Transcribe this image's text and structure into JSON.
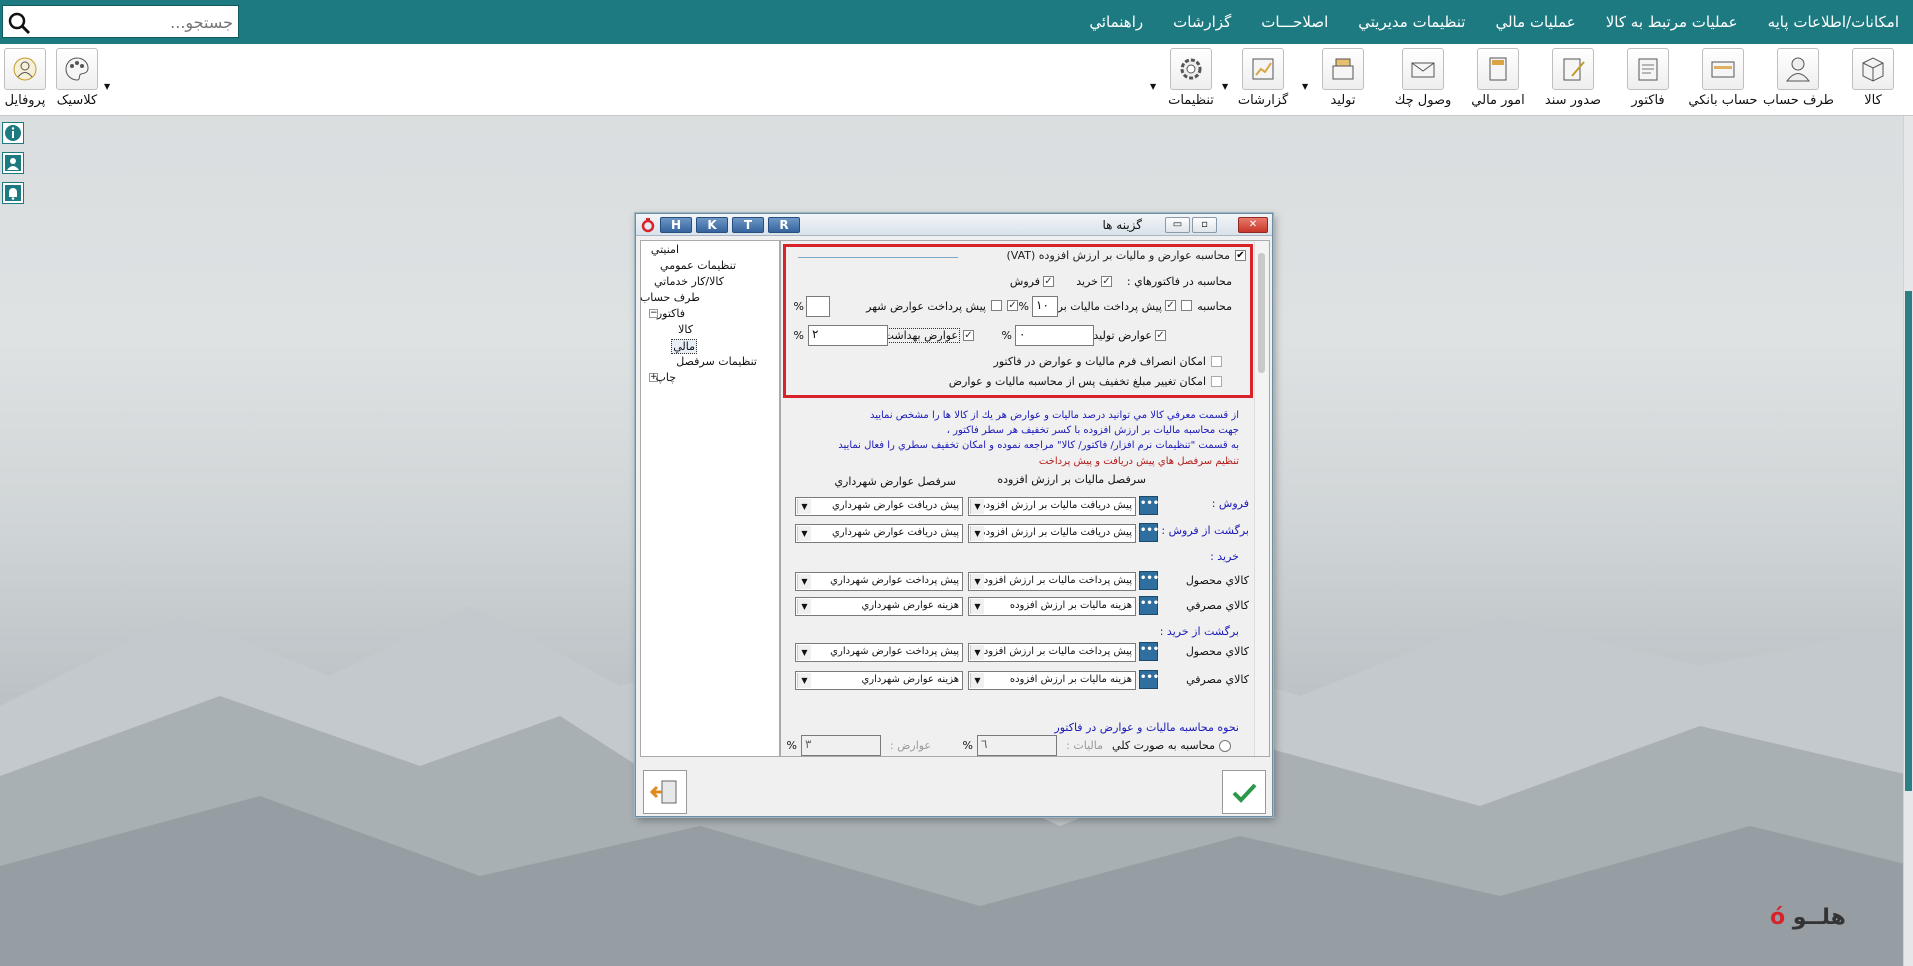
{
  "search": {
    "placeholder": "جستجو..."
  },
  "menu": [
    "امکانات/اطلاعات پايه",
    "عمليات مرتبط به کالا",
    "عمليات مالي",
    "تنظيمات مديريتي",
    "اصلاحـــات",
    "گزارشات",
    "راهنمائي"
  ],
  "toolbar": {
    "items": [
      "کالا",
      "طرف حساب",
      "حساب بانکي",
      "فاکتور",
      "صدور سند",
      "امور مالي",
      "وصول چك",
      "توليد",
      "گزارشات",
      "تنظيمات"
    ],
    "right_items": [
      "کلاسيک",
      "پروفايل"
    ]
  },
  "dialog": {
    "title": "گزينه ها",
    "hotkeys": [
      "H",
      "K",
      "T",
      "R"
    ],
    "tree": [
      "امنيتي",
      "تنظيمات عمومي",
      "کالا/کار خدماتي",
      "طرف حساب",
      "فاکتور",
      "کالا",
      "مالي",
      "تنظيمات سرفصل",
      "چاپ"
    ],
    "vat": {
      "header": "محاسبه عوارض و ماليات بر ارزش افزوده (VAT)",
      "calc_in": "محاسبه در فاکتورهاي  :",
      "buy": "خريد",
      "sell": "فروش",
      "calc": "محاسبه",
      "prepay_tax": "پيش پرداخت ماليات بر ا",
      "tax_value": "١٠",
      "prepay_city": "پيش پرداخت عوارض شهر",
      "city_value": "",
      "prod_duty": "عوارض توليد",
      "prod_value": "٠",
      "health_duty": "عوارض بهداشت",
      "health_value": "٢",
      "percent": "%",
      "opt1": "امکان انصراف فرم ماليات و عوارض در فاکتور",
      "opt2": "امکان تغيير مبلغ تخفيف پس از محاسبه ماليات و عوارض"
    },
    "info": [
      "از قسمت معرفي کالا مي توانيد درصد ماليات و عوارض هر يك از کالا ها را مشخص نماييد",
      "جهت محاسبه ماليات بر ارزش افزوده با کسر تخفيف هر سطر فاکتور ،",
      "به قسمت \"تنظيمات نرم افزار/ فاکتور/ کالا\" مراجعه نموده و امکان تخفيف سطري را فعال نماييد"
    ],
    "acct_title": "تنظيم سرفصل هاي پيش دريافت و پيش پرداخت",
    "col_tax": "سرفصل ماليات بر ارزش افزوده",
    "col_city": "سرفصل عوارض شهرداري",
    "rows": {
      "sell": "فروش  :",
      "sell_return": "برگشت از فروش :",
      "buy": "خريد :",
      "product": "کالاي محصول",
      "consumable": "کالاي مصرفي",
      "buy_return": "برگشت از خريد :"
    },
    "combos": {
      "pre_recv_tax": "پيش دريافت ماليات بر ارزش افزوده",
      "pre_recv_city": "پيش دريافت عوارض شهرداري",
      "pre_pay_tax": "پيش پرداخت ماليات بر ارزش افزوده",
      "pre_pay_city": "پيش پرداخت عوارض شهرداري",
      "cost_tax": "هزينه ماليات بر ارزش افزوده",
      "cost_city": "هزينه عوارض شهرداري"
    },
    "method_title": "نحوه محاسبه ماليات و عوارض در فاکتور",
    "method_total": "محاسبه به صورت کلي",
    "method_tax_label": "ماليات :",
    "method_tax_value": "٦",
    "method_duty_label": "عوارض :",
    "method_duty_value": "٣"
  },
  "logo": "هلــو"
}
